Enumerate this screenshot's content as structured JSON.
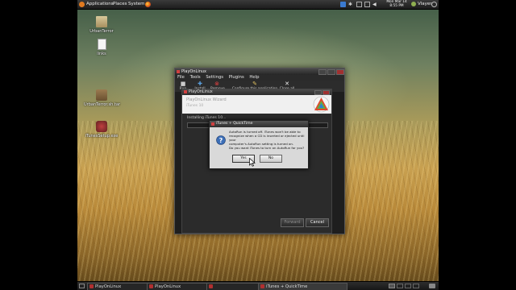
{
  "top_panel": {
    "menus": [
      "Applications",
      "Places",
      "System"
    ],
    "clock": "Mon Mar 14\n8:55 PM",
    "user": "Vlayer"
  },
  "desktop_icons": [
    {
      "label": "UrbanTerror",
      "icon": "folder-icon"
    },
    {
      "label": "links",
      "icon": "text-file-icon"
    },
    {
      "label": "UrbanTerror.sh.tar",
      "icon": "archive-icon"
    },
    {
      "label": "iTunesSetup.exe",
      "icon": "exe-installer-icon"
    }
  ],
  "main_window": {
    "title": "PlayOnLinux",
    "menu": [
      "File",
      "Tools",
      "Settings",
      "Plugins",
      "Help"
    ],
    "toolbar": [
      {
        "label": "Run",
        "icon": "run-icon"
      },
      {
        "label": "Install",
        "icon": "install-icon"
      },
      {
        "label": "Remove",
        "icon": "remove-icon"
      },
      {
        "label": "Configure this application",
        "icon": "configure-icon"
      },
      {
        "label": "Close all",
        "icon": "close-all-icon"
      }
    ]
  },
  "wizard": {
    "title": "PlayOnLinux",
    "header_title": "PlayOnLinux Wizard",
    "header_subtitle": "iTunes 10",
    "status": "Installing iTunes 10...",
    "next_label": "Forward",
    "cancel_label": "Cancel"
  },
  "dialog": {
    "title": "iTunes + QuickTime",
    "message": "AutoRun is turned off. iTunes won't be able to\nrecognize when a CD is inserted or ejected until your\ncomputer's AutoRun setting is turned on.\nDo you want iTunes to turn on AutoRun for you?",
    "yes_label": "Yes",
    "no_label": "No"
  },
  "taskbar": [
    {
      "label": "PlayOnLinux"
    },
    {
      "label": "PlayOnLinux"
    },
    {
      "label": ""
    },
    {
      "label": "iTunes + QuickTime"
    }
  ]
}
